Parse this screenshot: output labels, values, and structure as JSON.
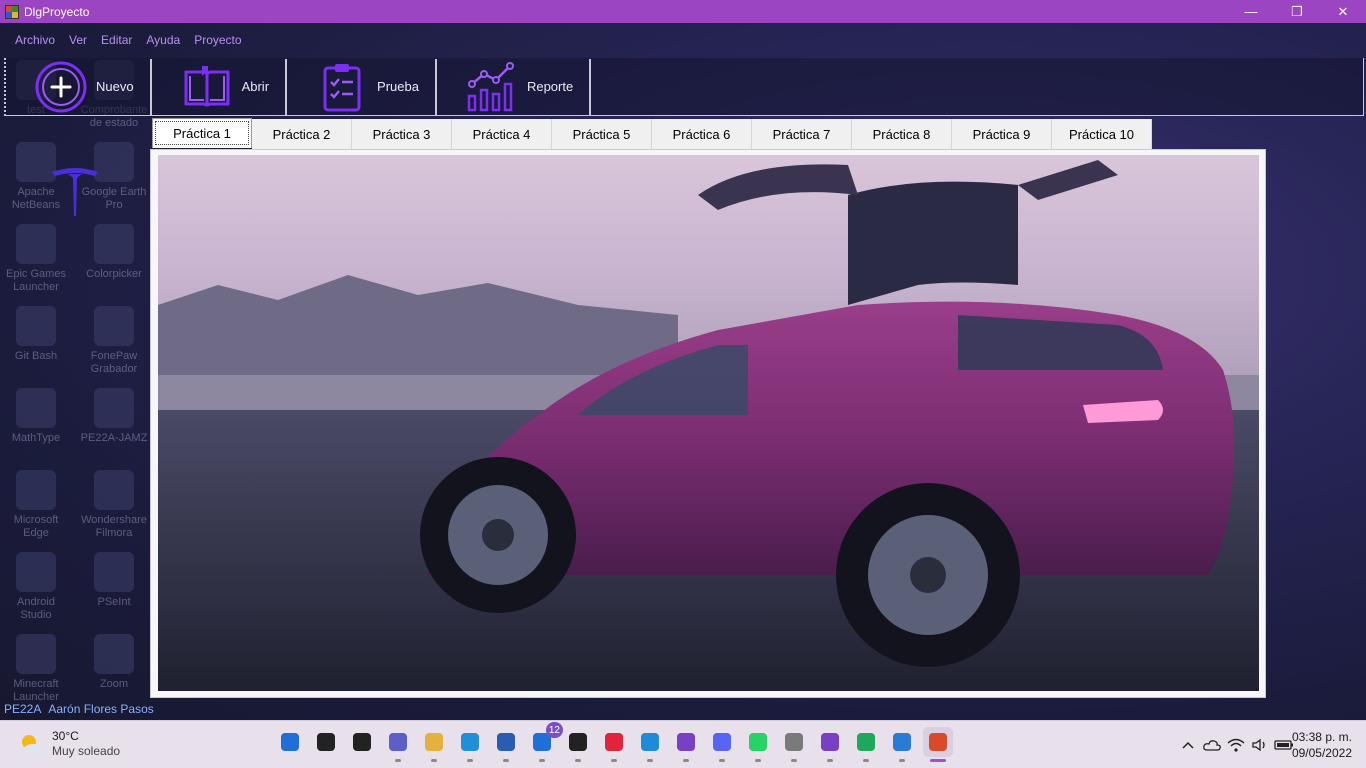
{
  "window": {
    "title": "DlgProyecto",
    "controls": {
      "minimize": "—",
      "maximize": "❐",
      "close": "✕"
    }
  },
  "menu": [
    "Archivo",
    "Ver",
    "Editar",
    "Ayuda",
    "Proyecto"
  ],
  "toolbar": [
    {
      "label": "Nuevo",
      "icon": "plus-circle-icon"
    },
    {
      "label": "Abrir",
      "icon": "open-book-icon"
    },
    {
      "label": "Prueba",
      "icon": "clipboard-check-icon"
    },
    {
      "label": "Reporte",
      "icon": "chart-report-icon"
    }
  ],
  "tabs": [
    "Práctica 1",
    "Práctica 2",
    "Práctica 3",
    "Práctica 4",
    "Práctica 5",
    "Práctica 6",
    "Práctica 7",
    "Práctica 8",
    "Práctica 9",
    "Práctica 10"
  ],
  "active_tab": "Práctica 1",
  "status": {
    "group": "PE22A",
    "author": "Aarón Flores Pasos"
  },
  "desktop_icons": [
    "test",
    "Comprobante de estado",
    "Apache NetBeans",
    "Google Earth Pro",
    "Epic Games Launcher",
    "Colorpicker",
    "Git Bash",
    "FonePaw Grabador",
    "MathType",
    "PE22A-JAMZ",
    "Microsoft Edge",
    "Wondershare Filmora",
    "Android Studio",
    "PSeInt",
    "Minecraft Launcher",
    "Zoom"
  ],
  "taskbar": {
    "weather": {
      "temp": "30°C",
      "desc": "Muy soleado"
    },
    "apps": [
      {
        "name": "windows-start-icon",
        "color": "#1f6fd6"
      },
      {
        "name": "search-icon",
        "color": "#222222"
      },
      {
        "name": "task-view-icon",
        "color": "#222222"
      },
      {
        "name": "meet-chat-icon",
        "color": "#5b5fc7"
      },
      {
        "name": "file-explorer-icon",
        "color": "#e3b23c"
      },
      {
        "name": "edge-icon",
        "color": "#1f8fd6"
      },
      {
        "name": "store-icon",
        "color": "#2a5db0"
      },
      {
        "name": "mail-icon",
        "color": "#1f6fd6",
        "badge": "12"
      },
      {
        "name": "media-player-icon",
        "color": "#222222"
      },
      {
        "name": "opera-icon",
        "color": "#e0243a"
      },
      {
        "name": "vscode-icon",
        "color": "#1f8ad6"
      },
      {
        "name": "visual-studio-icon",
        "color": "#7a3fc4"
      },
      {
        "name": "discord-icon",
        "color": "#5865f2"
      },
      {
        "name": "whatsapp-icon",
        "color": "#25d366"
      },
      {
        "name": "notes-app-icon",
        "color": "#7a7a7a"
      },
      {
        "name": "github-icon",
        "color": "#7a3fc4"
      },
      {
        "name": "green-app-icon",
        "color": "#1ea85c"
      },
      {
        "name": "photos-icon",
        "color": "#2a7ad6"
      },
      {
        "name": "dlgproyecto-app-icon",
        "color": "#d84a2a",
        "active": true
      }
    ],
    "tray": [
      "chevron-up-icon",
      "onedrive-icon",
      "wifi-icon",
      "volume-icon",
      "battery-icon"
    ],
    "time": "03:38 p. m.",
    "date": "09/05/2022"
  },
  "colors": {
    "titlebar": "#9c45c2",
    "accent_purple": "#7b2ff0",
    "menu_text": "#b98ff2",
    "status_text": "#8ab0ff"
  }
}
